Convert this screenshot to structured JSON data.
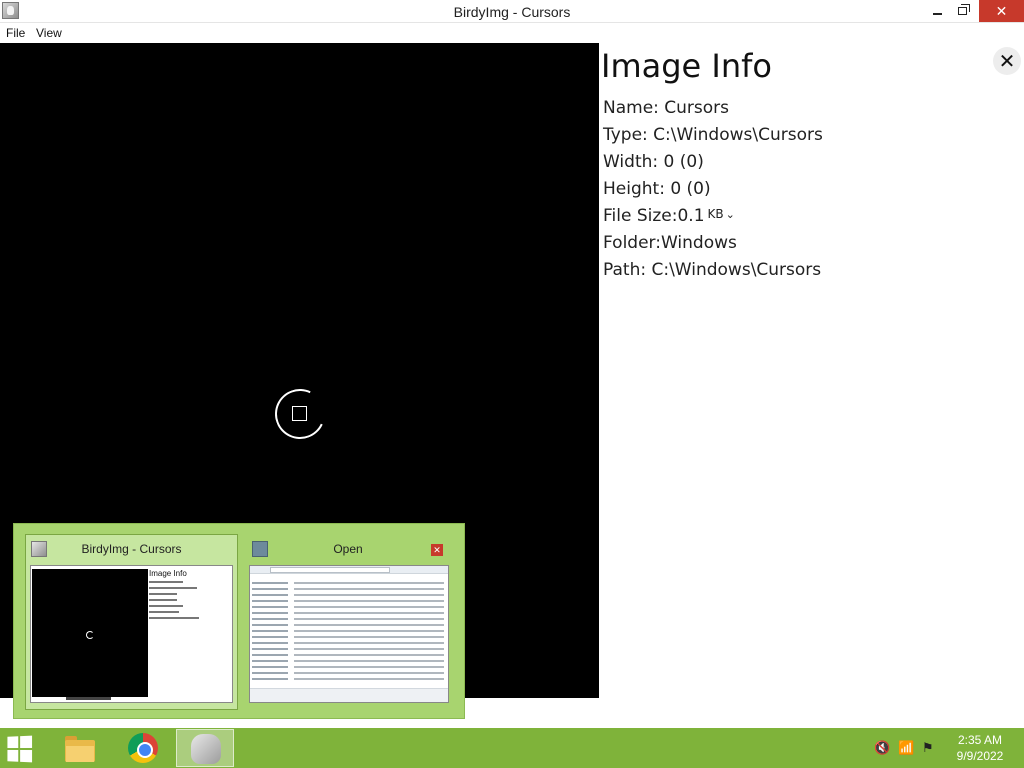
{
  "window": {
    "title": "BirdyImg - Cursors",
    "controls": {
      "minimize": "minimize",
      "maximize": "restore",
      "close": "✕"
    }
  },
  "menu": {
    "file": "File",
    "view": "View"
  },
  "info": {
    "title": "Image Info",
    "close_glyph": "✕",
    "name": "Name: Cursors",
    "type": "Type: C:\\Windows\\Cursors",
    "width": "Width: 0 (0)",
    "height": "Height: 0 (0)",
    "file_size_label": "File Size:0.1",
    "file_size_unit": "KB",
    "file_size_chevron": "⌄",
    "folder": "Folder:Windows",
    "path": "Path: C:\\Windows\\Cursors"
  },
  "flyout": {
    "preview1_title": "BirdyImg - Cursors",
    "preview1_thumb_title": "Image Info",
    "preview2_title": "Open",
    "preview2_close": "✕"
  },
  "taskbar": {
    "icons": [
      "windows-start-icon",
      "file-explorer-icon",
      "chrome-icon",
      "birdyimg-icon"
    ],
    "tray": {
      "speaker": "🔇",
      "network": "📶",
      "flag": "⚑"
    },
    "time": "2:35 AM",
    "date": "9/9/2022"
  },
  "colors": {
    "taskbar": "#7fb33a",
    "flyout": "#a8d46f",
    "viewer_bg": "#000000",
    "close_red": "#c7392b"
  }
}
